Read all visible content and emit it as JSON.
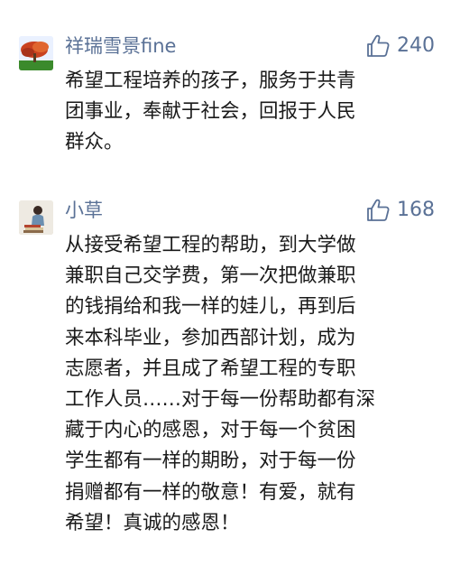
{
  "comments": [
    {
      "author": "祥瑞雪景fine",
      "likes": "240",
      "text": "希望工程培养的孩子，服务于共青\n团事业，奉献于社会，回报于人民\n群众。",
      "avatar_icon": "autumn-tree-photo"
    },
    {
      "author": "小草",
      "likes": "168",
      "text": "从接受希望工程的帮助，到大学做\n兼职自己交学费，第一次把做兼职\n的钱捐给和我一样的娃儿，再到后\n来本科毕业，参加西部计划，成为\n志愿者，并且成了希望工程的专职\n工作人员……对于每一份帮助都有深\n藏于内心的感恩，对于每一个贫困\n学生都有一样的期盼，对于每一份\n捐赠都有一样的敬意！有爱，就有\n希望！真诚的感恩！",
      "avatar_icon": "person-with-books-photo"
    }
  ],
  "colors": {
    "name": "#5a7196",
    "text": "#1a1a1a",
    "background": "#ffffff"
  },
  "icons": {
    "like": "thumbs-up-outline-icon"
  }
}
